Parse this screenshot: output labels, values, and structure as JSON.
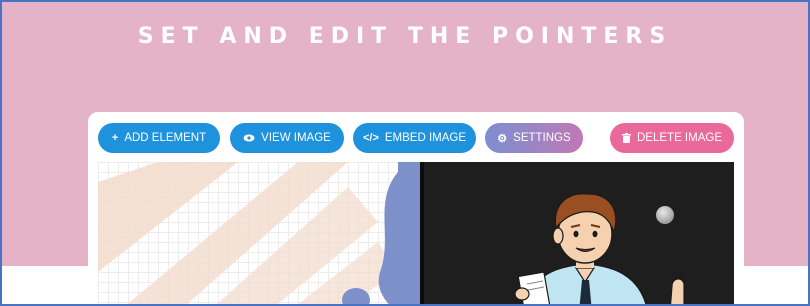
{
  "header": {
    "title": "SET AND EDIT THE POINTERS"
  },
  "toolbar": {
    "buttons": [
      {
        "label": "ADD ELEMENT",
        "icon": "plus-icon"
      },
      {
        "label": "VIEW IMAGE",
        "icon": "eye-icon"
      },
      {
        "label": "EMBED IMAGE",
        "icon": "code-icon"
      },
      {
        "label": "SETTINGS",
        "icon": "gear-icon"
      },
      {
        "label": "DELETE IMAGE",
        "icon": "trash-icon"
      }
    ]
  },
  "colors": {
    "hero_bg": "#e5b3c8",
    "primary_button": "#1e92dd",
    "settings_gradient_start": "#7c8fd0",
    "settings_gradient_end": "#bf79b5",
    "delete_button": "#e8699a",
    "blackboard": "#1e1e1e",
    "frame_border": "#4a73c4"
  },
  "canvas": {
    "image": "teacher-at-blackboard-illustration"
  }
}
